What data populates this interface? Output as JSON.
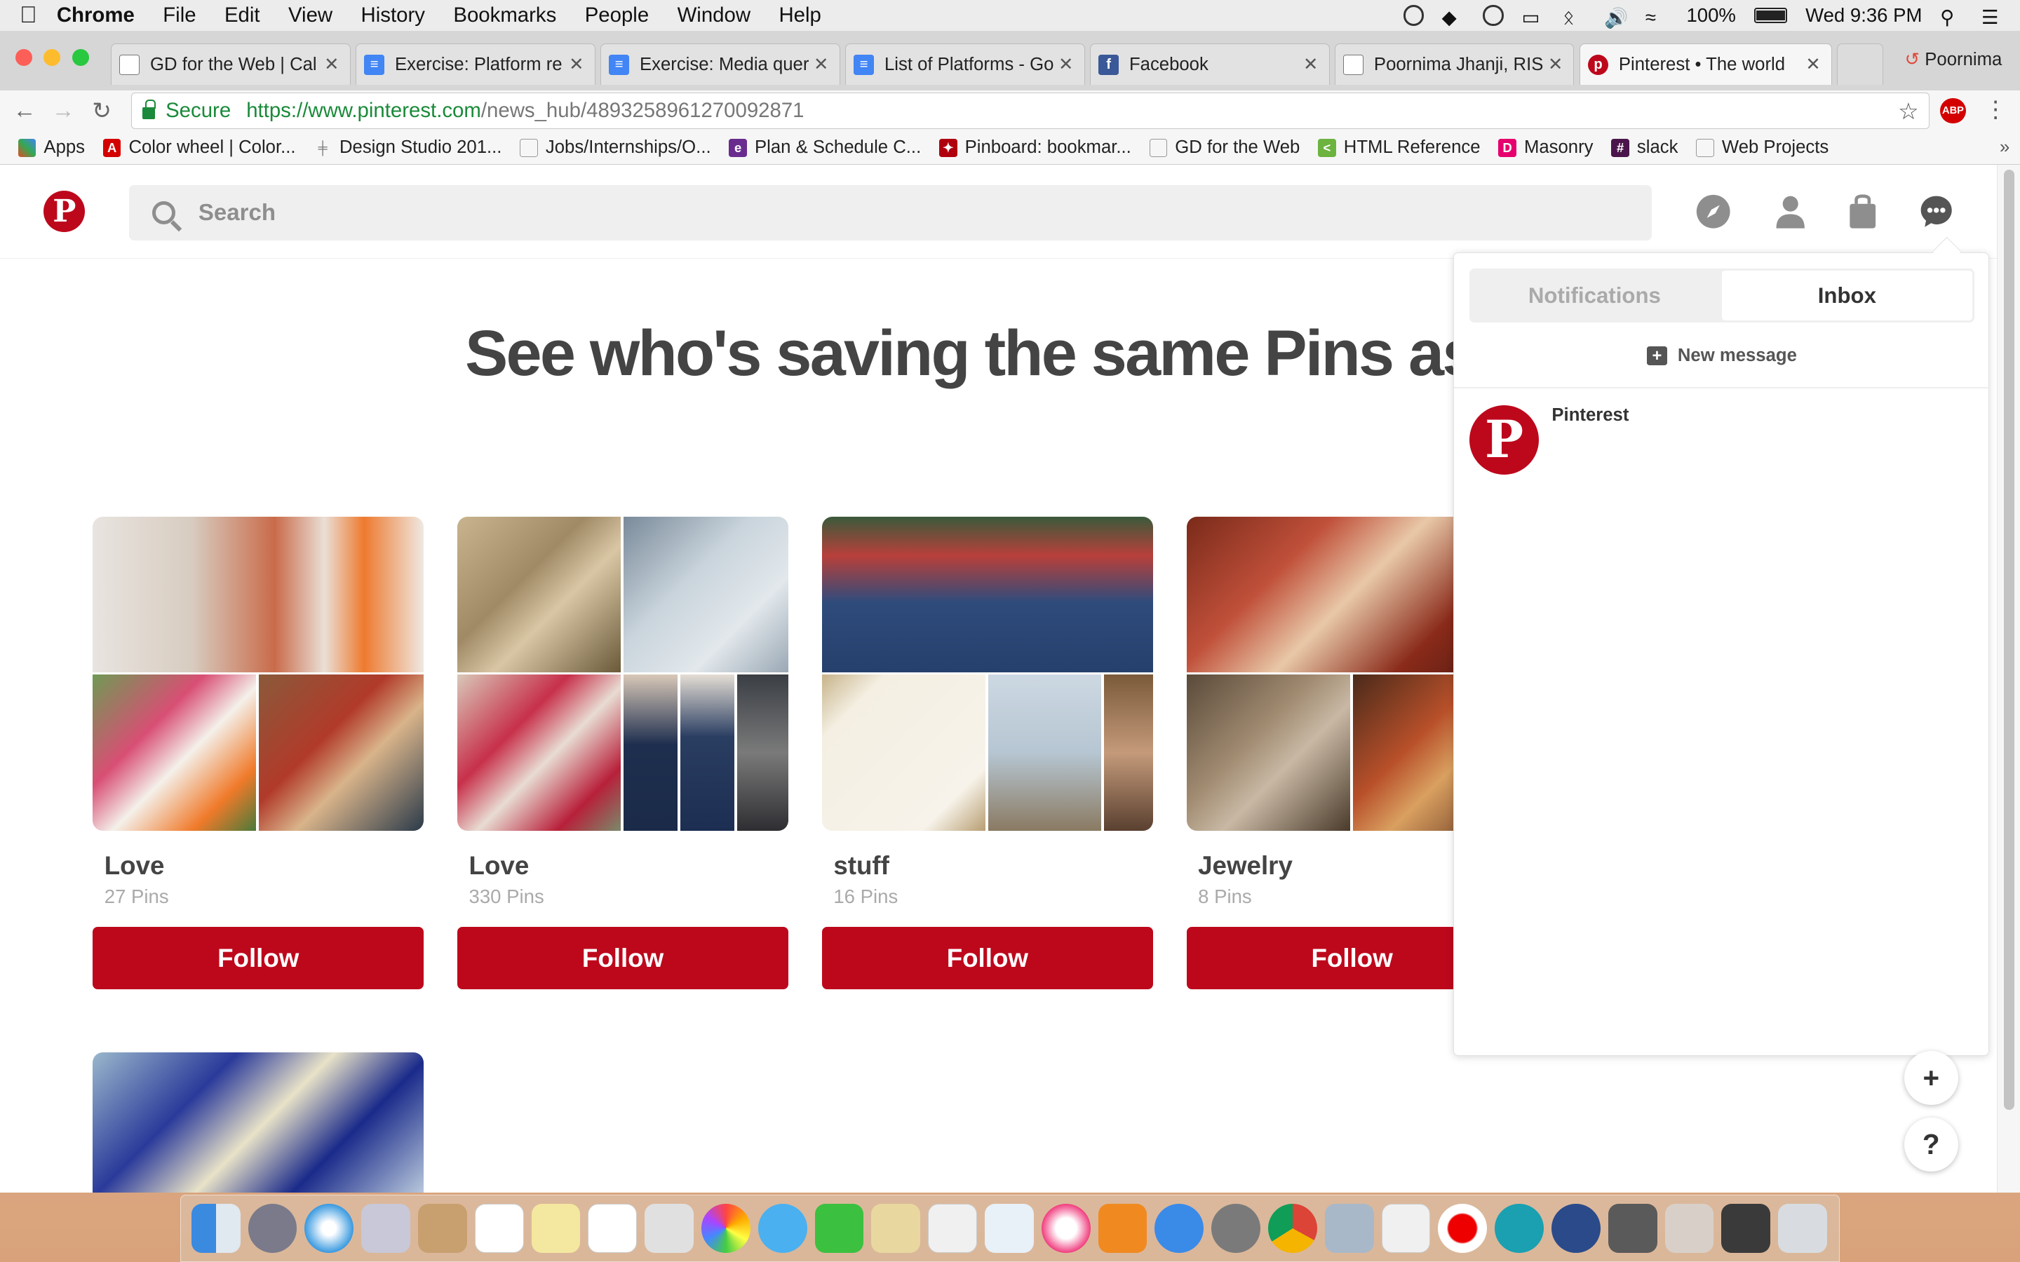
{
  "menubar": {
    "apple_icon": "apple-icon",
    "items": [
      "Chrome",
      "File",
      "Edit",
      "View",
      "History",
      "Bookmarks",
      "People",
      "Window",
      "Help"
    ],
    "battery": "100%",
    "clock": "Wed 9:36 PM"
  },
  "tabs": [
    {
      "title": "GD for the Web | Cal",
      "icon": "doc-icon",
      "color": "#777777"
    },
    {
      "title": "Exercise: Platform re",
      "icon": "google-docs-icon",
      "color": "#4285f4"
    },
    {
      "title": "Exercise: Media quer",
      "icon": "google-docs-icon",
      "color": "#4285f4"
    },
    {
      "title": "List of Platforms - Go",
      "icon": "google-docs-icon",
      "color": "#4285f4"
    },
    {
      "title": "Facebook",
      "icon": "facebook-icon",
      "color": "#3b5998"
    },
    {
      "title": "Poornima Jhanji, RIS",
      "icon": "doc-icon",
      "color": "#777777"
    },
    {
      "title": "Pinterest • The world",
      "icon": "pinterest-icon",
      "color": "#bd081c"
    }
  ],
  "profile_name": "Poornima",
  "url": {
    "secure_label": "Secure",
    "scheme_host": "https://www.pinterest.com",
    "path": "/news_hub/4893258961270092871"
  },
  "bookmarks": [
    {
      "label": "Apps",
      "icon": "apps-grid-icon",
      "color": "#e34c26"
    },
    {
      "label": "Color wheel | Color...",
      "icon": "adobe-icon",
      "color": "#d40000"
    },
    {
      "label": "Design Studio 201...",
      "icon": "bench-icon",
      "color": "#777777"
    },
    {
      "label": "Jobs/Internships/O...",
      "icon": "doc-icon",
      "color": "#999999"
    },
    {
      "label": "Plan & Schedule C...",
      "icon": "e-icon",
      "color": "#6a2b8e"
    },
    {
      "label": "Pinboard: bookmar...",
      "icon": "pinboard-icon",
      "color": "#b0000f"
    },
    {
      "label": "GD for the Web",
      "icon": "doc-icon",
      "color": "#999999"
    },
    {
      "label": "HTML Reference",
      "icon": "html-ref-icon",
      "color": "#6cb33f"
    },
    {
      "label": "Masonry",
      "icon": "masonry-icon",
      "color": "#e6006e"
    },
    {
      "label": "slack",
      "icon": "slack-icon",
      "color": "#4a154b"
    },
    {
      "label": "Web Projects",
      "icon": "doc-icon",
      "color": "#999999"
    }
  ],
  "pinterest": {
    "search_placeholder": "Search",
    "headline": "See who's saving the same Pins as you!",
    "boards": [
      {
        "name": "Love",
        "count": "27",
        "unit": " Pins",
        "follow": "Follow"
      },
      {
        "name": "Love",
        "count": "330",
        "unit": " Pins",
        "follow": "Follow"
      },
      {
        "name": "stuff",
        "count": "16",
        "unit": " Pins",
        "follow": "Follow"
      },
      {
        "name": "Jewelry",
        "count": "8",
        "unit": " Pins",
        "follow": "Follow"
      }
    ],
    "dropdown": {
      "tab_notifications": "Notifications",
      "tab_inbox": "Inbox",
      "new_message": "New message",
      "conversation_name": "Pinterest"
    },
    "fab_plus": "+",
    "fab_help": "?",
    "brand_color": "#bd081c"
  }
}
